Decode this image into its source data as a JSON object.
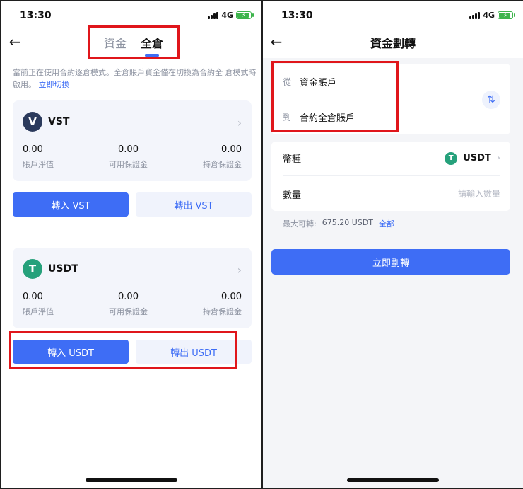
{
  "left_screen": {
    "status": {
      "time": "13:30",
      "network": "4G"
    },
    "tabs": [
      {
        "label": "資金",
        "active": false
      },
      {
        "label": "全倉",
        "active": true
      }
    ],
    "notice": {
      "text": "當前正在使用合約逐倉模式。全倉賬戶資金僅在切換為合約全 倉模式時啟用。",
      "link": "立即切換"
    },
    "accounts": [
      {
        "coin": "VST",
        "icon": "V",
        "stats": [
          {
            "value": "0.00",
            "label": "賬戶淨值"
          },
          {
            "value": "0.00",
            "label": "可用保證金"
          },
          {
            "value": "0.00",
            "label": "持倉保證金"
          }
        ],
        "transfer_in": "轉入 VST",
        "transfer_out": "轉出 VST"
      },
      {
        "coin": "USDT",
        "icon": "T",
        "stats": [
          {
            "value": "0.00",
            "label": "賬戶淨值"
          },
          {
            "value": "0.00",
            "label": "可用保證金"
          },
          {
            "value": "0.00",
            "label": "持倉保證金"
          }
        ],
        "transfer_in": "轉入 USDT",
        "transfer_out": "轉出 USDT"
      }
    ]
  },
  "right_screen": {
    "status": {
      "time": "13:30",
      "network": "4G"
    },
    "title": "資金劃轉",
    "transfer": {
      "from_tag": "從",
      "from_value": "資金賬戶",
      "to_tag": "到",
      "to_value": "合約全倉賬戶"
    },
    "form": {
      "coin_label": "幣種",
      "coin_value": "USDT",
      "amount_label": "數量",
      "amount_placeholder": "請輸入數量"
    },
    "max": {
      "label": "最大可轉:",
      "value": "675.20 USDT",
      "all_link": "全部"
    },
    "submit_label": "立即劃轉"
  },
  "colors": {
    "accent": "#3e6df5",
    "highlight": "#e0161b",
    "usdt": "#26a17b",
    "vst": "#2b3a5c"
  }
}
